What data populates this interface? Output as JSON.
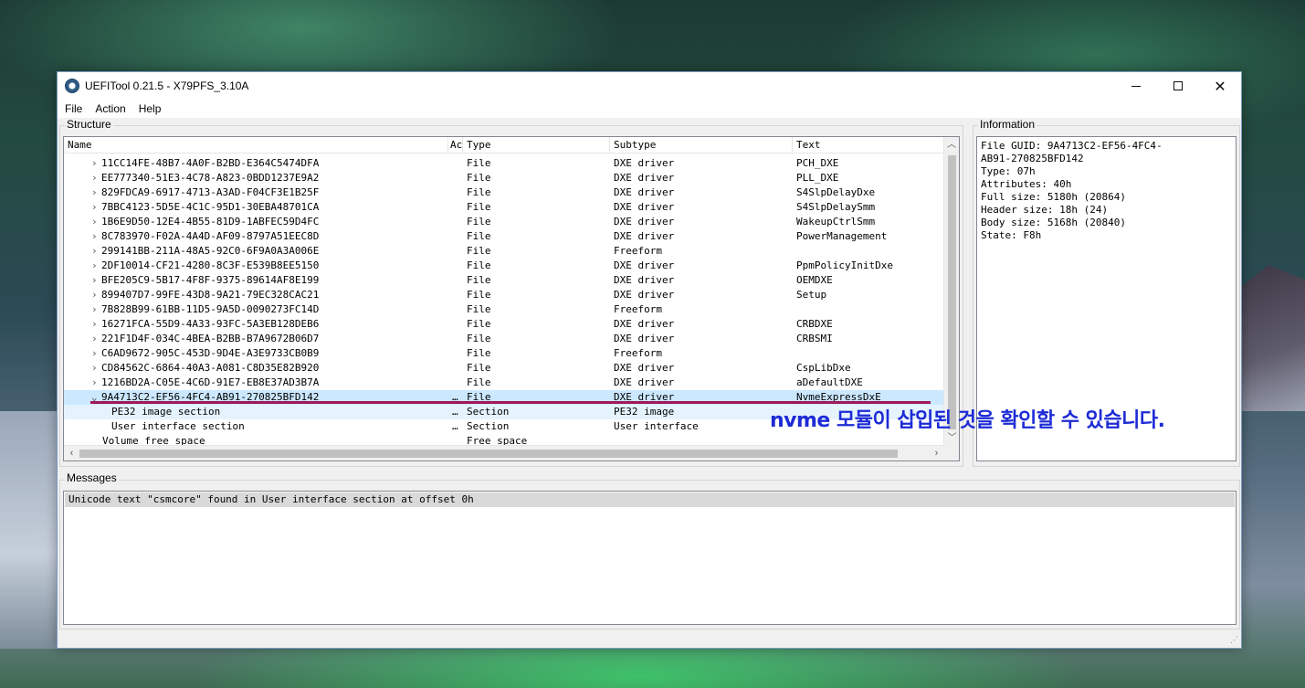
{
  "window": {
    "title": "UEFITool 0.21.5 - X79PFS_3.10A"
  },
  "menu": [
    "File",
    "Action",
    "Help"
  ],
  "structure": {
    "label": "Structure",
    "columns": [
      "Name",
      "Ac",
      "Type",
      "Subtype",
      "Text"
    ],
    "rows": [
      {
        "name": "11CC14FE-48B7-4A0F-B2BD-E364C5474DFA",
        "a": "",
        "type": "File",
        "subtype": "DXE driver",
        "text": "PCH_DXE",
        "expander": "collapsed"
      },
      {
        "name": "EE777340-51E3-4C78-A823-0BDD1237E9A2",
        "a": "",
        "type": "File",
        "subtype": "DXE driver",
        "text": "PLL_DXE",
        "expander": "collapsed"
      },
      {
        "name": "829FDCA9-6917-4713-A3AD-F04CF3E1B25F",
        "a": "",
        "type": "File",
        "subtype": "DXE driver",
        "text": "S4SlpDelayDxe",
        "expander": "collapsed"
      },
      {
        "name": "7BBC4123-5D5E-4C1C-95D1-30EBA48701CA",
        "a": "",
        "type": "File",
        "subtype": "DXE driver",
        "text": "S4SlpDelaySmm",
        "expander": "collapsed"
      },
      {
        "name": "1B6E9D50-12E4-4B55-81D9-1ABFEC59D4FC",
        "a": "",
        "type": "File",
        "subtype": "DXE driver",
        "text": "WakeupCtrlSmm",
        "expander": "collapsed"
      },
      {
        "name": "8C783970-F02A-4A4D-AF09-8797A51EEC8D",
        "a": "",
        "type": "File",
        "subtype": "DXE driver",
        "text": "PowerManagement",
        "expander": "collapsed"
      },
      {
        "name": "299141BB-211A-48A5-92C0-6F9A0A3A006E",
        "a": "",
        "type": "File",
        "subtype": "Freeform",
        "text": "",
        "expander": "collapsed"
      },
      {
        "name": "2DF10014-CF21-4280-8C3F-E539B8EE5150",
        "a": "",
        "type": "File",
        "subtype": "DXE driver",
        "text": "PpmPolicyInitDxe",
        "expander": "collapsed"
      },
      {
        "name": "BFE205C9-5B17-4F8F-9375-89614AF8E199",
        "a": "",
        "type": "File",
        "subtype": "DXE driver",
        "text": "OEMDXE",
        "expander": "collapsed"
      },
      {
        "name": "899407D7-99FE-43D8-9A21-79EC328CAC21",
        "a": "",
        "type": "File",
        "subtype": "DXE driver",
        "text": "Setup",
        "expander": "collapsed"
      },
      {
        "name": "7B828B99-61BB-11D5-9A5D-0090273FC14D",
        "a": "",
        "type": "File",
        "subtype": "Freeform",
        "text": "",
        "expander": "collapsed"
      },
      {
        "name": "16271FCA-55D9-4A33-93FC-5A3EB128DEB6",
        "a": "",
        "type": "File",
        "subtype": "DXE driver",
        "text": "CRBDXE",
        "expander": "collapsed"
      },
      {
        "name": "221F1D4F-034C-4BEA-B2BB-B7A9672B06D7",
        "a": "",
        "type": "File",
        "subtype": "DXE driver",
        "text": "CRBSMI",
        "expander": "collapsed"
      },
      {
        "name": "C6AD9672-905C-453D-9D4E-A3E9733CB0B9",
        "a": "",
        "type": "File",
        "subtype": "Freeform",
        "text": "",
        "expander": "collapsed"
      },
      {
        "name": "CD84562C-6864-40A3-A081-C8D35E82B920",
        "a": "",
        "type": "File",
        "subtype": "DXE driver",
        "text": "CspLibDxe",
        "expander": "collapsed"
      },
      {
        "name": "1216BD2A-C05E-4C6D-91E7-EB8E37AD3B7A",
        "a": "",
        "type": "File",
        "subtype": "DXE driver",
        "text": "aDefaultDXE",
        "expander": "collapsed"
      },
      {
        "name": "9A4713C2-EF56-4FC4-AB91-270825BFD142",
        "a": "…",
        "type": "File",
        "subtype": "DXE driver",
        "text": "NvmeExpressDxE",
        "expander": "expanded",
        "state": "selected"
      },
      {
        "name": "PE32 image section",
        "a": "…",
        "type": "Section",
        "subtype": "PE32 image",
        "text": "",
        "expander": "none",
        "level": 2,
        "state": "selected-child"
      },
      {
        "name": "User interface section",
        "a": "…",
        "type": "Section",
        "subtype": "User interface",
        "text": "",
        "expander": "none",
        "level": 2
      },
      {
        "name": "Volume free space",
        "a": "",
        "type": "Free space",
        "subtype": "",
        "text": "",
        "expander": "none",
        "level": 1
      }
    ]
  },
  "information": {
    "label": "Information",
    "lines": [
      "File GUID: 9A4713C2-EF56-4FC4-",
      "AB91-270825BFD142",
      "Type: 07h",
      "Attributes: 40h",
      "Full size: 5180h (20864)",
      "Header size: 18h (24)",
      "Body size: 5168h (20840)",
      "State: F8h"
    ]
  },
  "messages": {
    "label": "Messages",
    "items": [
      "Unicode text \"csmcore\" found in User interface section at offset 0h"
    ]
  },
  "annotation": {
    "text": "nvme 모듈이 삽입된 것을 확인할 수 있습니다.",
    "color": "#1d2bd6",
    "underline_color": "#a0185a"
  }
}
